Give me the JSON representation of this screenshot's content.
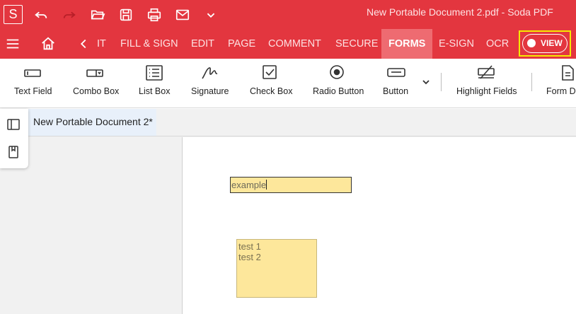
{
  "app": {
    "logo_letter": "S",
    "document_title": "New Portable Document 2.pdf  -  Soda PDF",
    "colors": {
      "brand_red": "#e3363f",
      "active_tab": "#ee6b71",
      "highlight_box": "#f5e900",
      "form_field_fill": "#fde79b"
    }
  },
  "titlebar": {
    "icons": [
      "undo-icon",
      "redo-icon",
      "open-folder-icon",
      "save-icon",
      "print-icon",
      "mail-icon",
      "chevron-down-icon"
    ]
  },
  "ribbon": {
    "menu_icon": "hamburger-icon",
    "home_icon": "home-icon",
    "back_icon": "chevron-left-icon",
    "tabs": [
      {
        "label": "IT"
      },
      {
        "label": "FILL & SIGN"
      },
      {
        "label": "EDIT"
      },
      {
        "label": "PAGE"
      },
      {
        "label": "COMMENT"
      },
      {
        "label": "SECURE"
      },
      {
        "label": "FORMS"
      },
      {
        "label": "E-SIGN"
      },
      {
        "label": "OCR"
      }
    ],
    "active_tab": "FORMS",
    "view_toggle_label": "VIEW"
  },
  "toolbar": {
    "items": [
      {
        "label": "Text Field",
        "icon": "text-field-icon"
      },
      {
        "label": "Combo Box",
        "icon": "combo-box-icon"
      },
      {
        "label": "List Box",
        "icon": "list-box-icon"
      },
      {
        "label": "Signature",
        "icon": "signature-icon"
      },
      {
        "label": "Check Box",
        "icon": "check-box-icon"
      },
      {
        "label": "Radio Button",
        "icon": "radio-button-icon"
      },
      {
        "label": "Button",
        "icon": "button-icon"
      },
      {
        "label": "Highlight Fields",
        "icon": "highlight-fields-icon"
      },
      {
        "label": "Form D",
        "icon": "form-data-icon"
      }
    ]
  },
  "document": {
    "tab_title": "New Portable Document 2*",
    "text_field_value": "example",
    "list_box_items": [
      "test 1",
      "test 2"
    ]
  }
}
